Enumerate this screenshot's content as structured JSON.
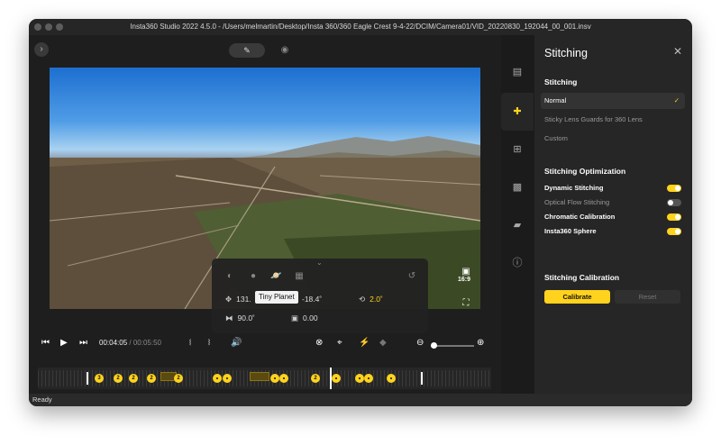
{
  "window": {
    "title": "Insta360 Studio 2022 4.5.0 - /Users/melmartin/Desktop/Insta 360/360 Eagle Crest 9-4-22/DCIM/Camera01/VID_20220830_192044_00_001.insv"
  },
  "preview": {
    "aspect_ratio": "16:9"
  },
  "view_popup": {
    "tooltip": "Tiny Planet",
    "params": {
      "pan": "131.",
      "tilt": "-18.4˚",
      "roll": "2.0˚",
      "fov": "90.0˚",
      "distance": "0.00"
    }
  },
  "playback": {
    "current_time": "00:04:05",
    "separator": "/",
    "duration": "00:05:50"
  },
  "timeline": {
    "keyframes": [
      "3",
      "2",
      "2",
      "2",
      "2",
      "2"
    ]
  },
  "panel": {
    "title": "Stitching",
    "stitching": {
      "heading": "Stitching",
      "options": [
        "Normal",
        "Sticky Lens Guards for 360 Lens",
        "Custom"
      ],
      "selected": "Normal",
      "check": "✓"
    },
    "optimization": {
      "heading": "Stitching Optimization",
      "toggles": [
        {
          "label": "Dynamic Stitching",
          "on": true
        },
        {
          "label": "Optical Flow Stitching",
          "on": false
        },
        {
          "label": "Chromatic Calibration",
          "on": true
        },
        {
          "label": "Insta360 Sphere",
          "on": true
        }
      ]
    },
    "calibration": {
      "heading": "Stitching Calibration",
      "calibrate_label": "Calibrate",
      "reset_label": "Reset"
    }
  },
  "status": {
    "text": "Ready"
  },
  "colors": {
    "accent": "#ffd21e",
    "background": "#1e1e1e",
    "panel": "#262626"
  }
}
